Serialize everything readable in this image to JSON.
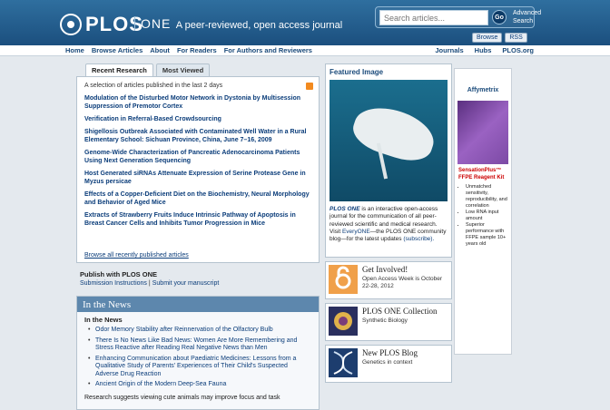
{
  "header": {
    "logo_text": "PLOS",
    "journal_name": "ONE",
    "tagline": "A peer-reviewed, open access journal",
    "search_placeholder": "Search articles...",
    "go_label": "Go",
    "advanced_line1": "Advanced",
    "advanced_line2": "Search",
    "browse_label": "Browse",
    "rss_label": "RSS"
  },
  "nav": {
    "left": [
      "Home",
      "Browse Articles",
      "About",
      "For Readers",
      "For Authors and Reviewers"
    ],
    "right": [
      "Journals",
      "Hubs",
      "PLOS.org"
    ]
  },
  "recent": {
    "tab_recent": "Recent Research",
    "tab_most_viewed": "Most Viewed",
    "caption": "A selection of articles published in the last 2 days",
    "articles": [
      "Modulation of the Disturbed Motor Network in Dystonia by Multisession Suppression of Premotor Cortex",
      "Verification in Referral-Based Crowdsourcing",
      "Shigellosis Outbreak Associated with Contaminated Well Water in a Rural Elementary School: Sichuan Province, China, June 7–16, 2009",
      "Genome-Wide Characterization of Pancreatic Adenocarcinoma Patients Using Next Generation Sequencing",
      "Host Generated siRNAs Attenuate Expression of Serine Protease Gene in Myzus persicae",
      "Effects of a Copper-Deficient Diet on the Biochemistry, Neural Morphology and Behavior of Aged Mice",
      "Extracts of Strawberry Fruits Induce Intrinsic Pathway of Apoptosis in Breast Cancer Cells and Inhibits Tumor Progression in Mice"
    ],
    "browse_all": "Browse all recently published articles"
  },
  "publish": {
    "title": "Publish with PLOS ONE",
    "link1": "Submission Instructions",
    "link2": "Submit your manuscript"
  },
  "news": {
    "heading": "In the News",
    "subheading": "In the News",
    "items": [
      "Odor Memory Stability after Reinnervation of the Olfactory Bulb",
      "There Is No News Like Bad News: Women Are More Remembering and Stress Reactive after Reading Real Negative News than Men",
      "Enhancing Communication about Paediatric Medicines: Lessons from a Qualitative Study of Parents' Experiences of Their Child's Suspected Adverse Drug Reaction",
      "Ancient Origin of the Modern Deep-Sea Fauna"
    ],
    "footer": "Research suggests viewing cute animals may improve focus and task"
  },
  "featured": {
    "title": "Featured Image",
    "text_em": "PLOS ONE",
    "text_a": " is an interactive open-access journal for the communication of all peer-reviewed scientific and medical research. Visit ",
    "text_link": "EveryONE",
    "text_b": "—the PLOS ONE community blog—for the latest updates ",
    "text_sub": "(subscribe)."
  },
  "boxes": [
    {
      "title": "Get Involved!",
      "desc": "Open Access Week is October 22-28, 2012"
    },
    {
      "title": "PLOS ONE Collection",
      "desc": "Synthetic Biology"
    },
    {
      "title": "New PLOS Blog",
      "desc": "Genetics in context"
    }
  ],
  "ad": {
    "brand": "Affymetrix",
    "product": "SensationPlus™",
    "product2": "FFPE Reagent Kit",
    "points": [
      "Unmatched sensitivity, reproducibility, and correlation",
      "Low RNA input amount",
      "Superior performance with FFPE sample 10+ years old"
    ]
  }
}
